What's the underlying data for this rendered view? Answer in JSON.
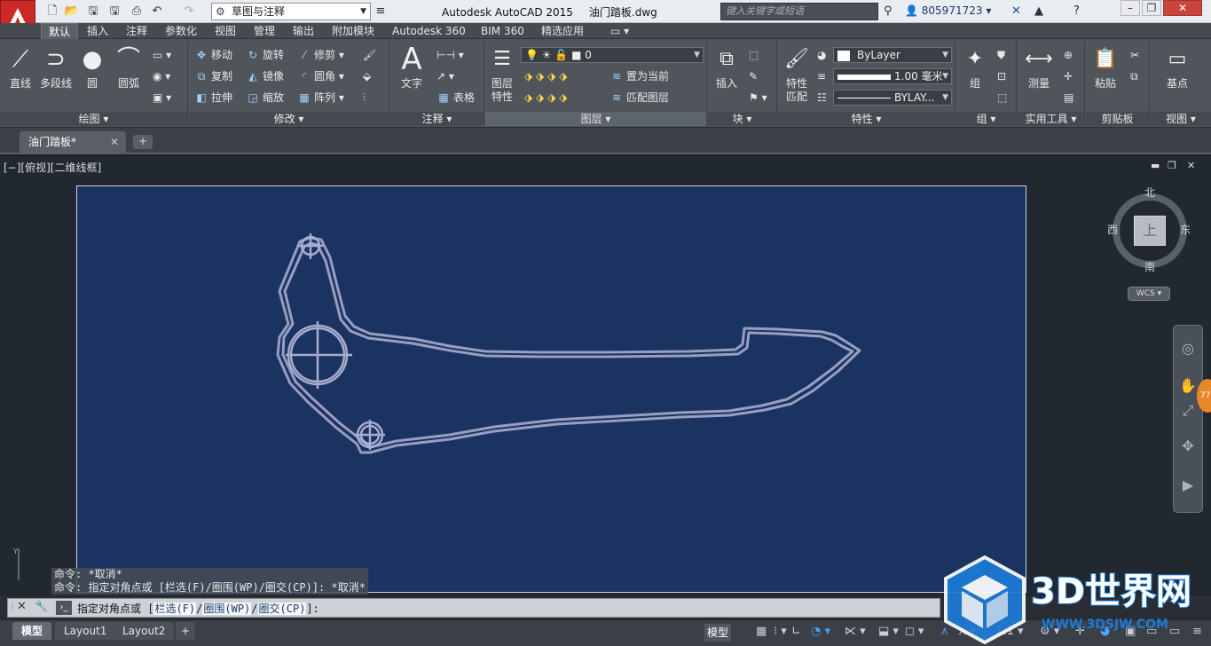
{
  "titlebar": {
    "workspace": "草图与注释",
    "app_title": "Autodesk AutoCAD 2015",
    "file_name": "油门踏板.dwg",
    "search_placeholder": "键入关键字或短语",
    "user_id": "805971723"
  },
  "ribbon_tabs": [
    "默认",
    "插入",
    "注释",
    "参数化",
    "视图",
    "管理",
    "输出",
    "附加模块",
    "Autodesk 360",
    "BIM 360",
    "精选应用"
  ],
  "ribbon": {
    "draw": {
      "title": "绘图",
      "line": "直线",
      "polyline": "多段线",
      "circle": "圆",
      "arc": "圆弧"
    },
    "modify": {
      "title": "修改",
      "move": "移动",
      "rotate": "旋转",
      "trim": "修剪",
      "copy": "复制",
      "mirror": "镜像",
      "fillet": "圆角",
      "stretch": "拉伸",
      "scale": "缩放",
      "array": "阵列"
    },
    "annotation": {
      "title": "注释",
      "text": "文字",
      "table": "表格"
    },
    "layers": {
      "title": "图层",
      "layer_props": "图层",
      "layer_props2": "特性",
      "layer_value": "0",
      "set_current": "置为当前",
      "match_layer": "匹配图层"
    },
    "block": {
      "title": "块",
      "insert": "插入"
    },
    "properties": {
      "title": "特性",
      "match": "特性",
      "match2": "匹配",
      "color": "ByLayer",
      "lineweight": "1.00 毫米",
      "linetype": "BYLAY..."
    },
    "groups": {
      "title": "组",
      "group": "组"
    },
    "utilities": {
      "title": "实用工具",
      "measure": "测量"
    },
    "clipboard": {
      "title": "剪贴板",
      "paste": "粘贴"
    },
    "view": {
      "title": "视图",
      "base": "基点"
    }
  },
  "doc_tab": "油门踏板*",
  "viewport": {
    "label": "[−][俯视][二维线框]",
    "viewcube": {
      "north": "北",
      "south": "南",
      "east": "东",
      "west": "西",
      "face": "上"
    },
    "wcs": "WCS",
    "badge": "77"
  },
  "history": [
    "命令: *取消*",
    "命令: 指定对角点或 [栏选(F)/圈围(WP)/圈交(CP)]: *取消*"
  ],
  "command": {
    "prompt": "指定对角点或 [",
    "opt1": "栏选(F)",
    "opt2": "圈围(WP)",
    "opt3": "圈交(CP)",
    "end": "]:"
  },
  "status": {
    "model_tab": "模型",
    "layout1": "Layout1",
    "layout2": "Layout2",
    "model_btn": "模型",
    "scale": "1:1"
  },
  "watermark": {
    "brand": "3D世界网",
    "url": "WWW.3DSJW.COM"
  }
}
